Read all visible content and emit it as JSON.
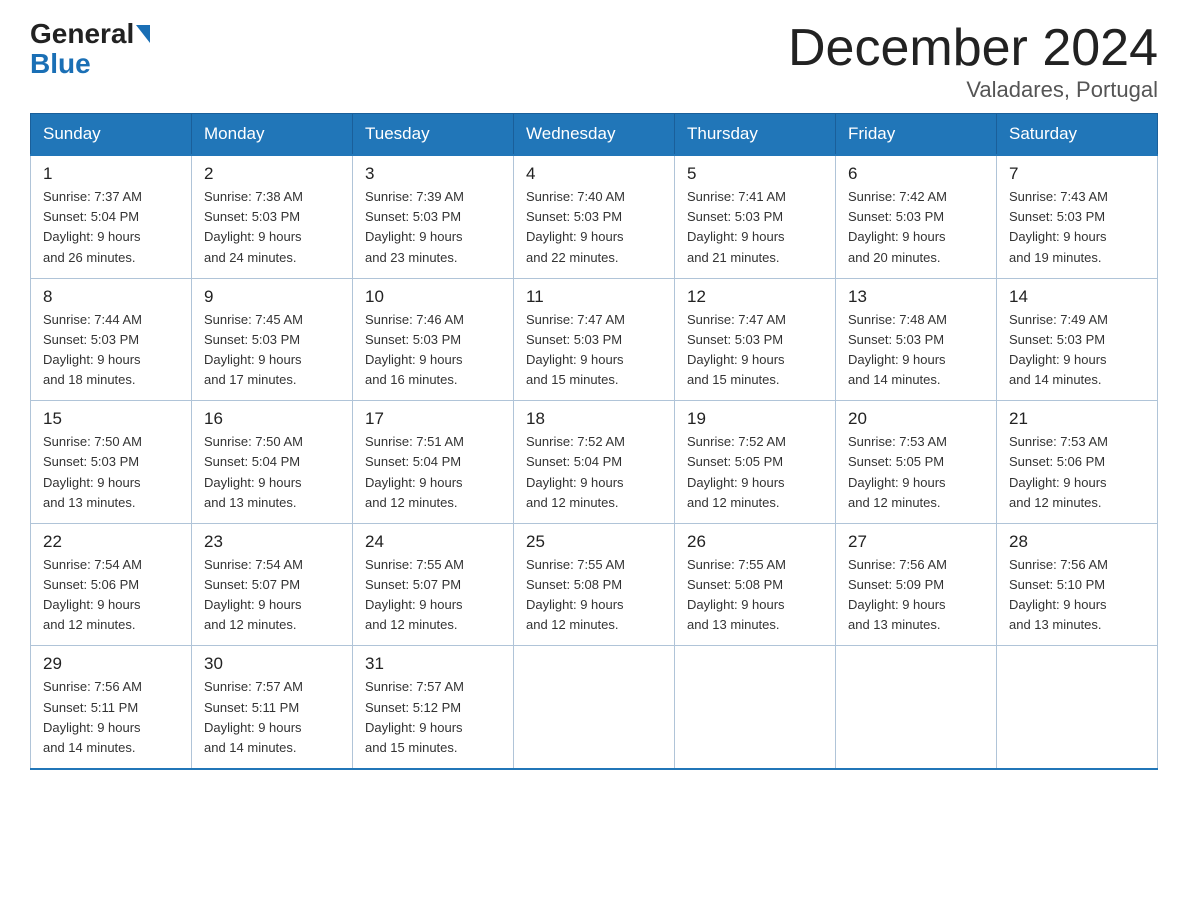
{
  "logo": {
    "general": "General",
    "blue": "Blue"
  },
  "header": {
    "month": "December 2024",
    "location": "Valadares, Portugal"
  },
  "days_of_week": [
    "Sunday",
    "Monday",
    "Tuesday",
    "Wednesday",
    "Thursday",
    "Friday",
    "Saturday"
  ],
  "weeks": [
    [
      {
        "day": "1",
        "sunrise": "7:37 AM",
        "sunset": "5:04 PM",
        "daylight": "9 hours and 26 minutes."
      },
      {
        "day": "2",
        "sunrise": "7:38 AM",
        "sunset": "5:03 PM",
        "daylight": "9 hours and 24 minutes."
      },
      {
        "day": "3",
        "sunrise": "7:39 AM",
        "sunset": "5:03 PM",
        "daylight": "9 hours and 23 minutes."
      },
      {
        "day": "4",
        "sunrise": "7:40 AM",
        "sunset": "5:03 PM",
        "daylight": "9 hours and 22 minutes."
      },
      {
        "day": "5",
        "sunrise": "7:41 AM",
        "sunset": "5:03 PM",
        "daylight": "9 hours and 21 minutes."
      },
      {
        "day": "6",
        "sunrise": "7:42 AM",
        "sunset": "5:03 PM",
        "daylight": "9 hours and 20 minutes."
      },
      {
        "day": "7",
        "sunrise": "7:43 AM",
        "sunset": "5:03 PM",
        "daylight": "9 hours and 19 minutes."
      }
    ],
    [
      {
        "day": "8",
        "sunrise": "7:44 AM",
        "sunset": "5:03 PM",
        "daylight": "9 hours and 18 minutes."
      },
      {
        "day": "9",
        "sunrise": "7:45 AM",
        "sunset": "5:03 PM",
        "daylight": "9 hours and 17 minutes."
      },
      {
        "day": "10",
        "sunrise": "7:46 AM",
        "sunset": "5:03 PM",
        "daylight": "9 hours and 16 minutes."
      },
      {
        "day": "11",
        "sunrise": "7:47 AM",
        "sunset": "5:03 PM",
        "daylight": "9 hours and 15 minutes."
      },
      {
        "day": "12",
        "sunrise": "7:47 AM",
        "sunset": "5:03 PM",
        "daylight": "9 hours and 15 minutes."
      },
      {
        "day": "13",
        "sunrise": "7:48 AM",
        "sunset": "5:03 PM",
        "daylight": "9 hours and 14 minutes."
      },
      {
        "day": "14",
        "sunrise": "7:49 AM",
        "sunset": "5:03 PM",
        "daylight": "9 hours and 14 minutes."
      }
    ],
    [
      {
        "day": "15",
        "sunrise": "7:50 AM",
        "sunset": "5:03 PM",
        "daylight": "9 hours and 13 minutes."
      },
      {
        "day": "16",
        "sunrise": "7:50 AM",
        "sunset": "5:04 PM",
        "daylight": "9 hours and 13 minutes."
      },
      {
        "day": "17",
        "sunrise": "7:51 AM",
        "sunset": "5:04 PM",
        "daylight": "9 hours and 12 minutes."
      },
      {
        "day": "18",
        "sunrise": "7:52 AM",
        "sunset": "5:04 PM",
        "daylight": "9 hours and 12 minutes."
      },
      {
        "day": "19",
        "sunrise": "7:52 AM",
        "sunset": "5:05 PM",
        "daylight": "9 hours and 12 minutes."
      },
      {
        "day": "20",
        "sunrise": "7:53 AM",
        "sunset": "5:05 PM",
        "daylight": "9 hours and 12 minutes."
      },
      {
        "day": "21",
        "sunrise": "7:53 AM",
        "sunset": "5:06 PM",
        "daylight": "9 hours and 12 minutes."
      }
    ],
    [
      {
        "day": "22",
        "sunrise": "7:54 AM",
        "sunset": "5:06 PM",
        "daylight": "9 hours and 12 minutes."
      },
      {
        "day": "23",
        "sunrise": "7:54 AM",
        "sunset": "5:07 PM",
        "daylight": "9 hours and 12 minutes."
      },
      {
        "day": "24",
        "sunrise": "7:55 AM",
        "sunset": "5:07 PM",
        "daylight": "9 hours and 12 minutes."
      },
      {
        "day": "25",
        "sunrise": "7:55 AM",
        "sunset": "5:08 PM",
        "daylight": "9 hours and 12 minutes."
      },
      {
        "day": "26",
        "sunrise": "7:55 AM",
        "sunset": "5:08 PM",
        "daylight": "9 hours and 13 minutes."
      },
      {
        "day": "27",
        "sunrise": "7:56 AM",
        "sunset": "5:09 PM",
        "daylight": "9 hours and 13 minutes."
      },
      {
        "day": "28",
        "sunrise": "7:56 AM",
        "sunset": "5:10 PM",
        "daylight": "9 hours and 13 minutes."
      }
    ],
    [
      {
        "day": "29",
        "sunrise": "7:56 AM",
        "sunset": "5:11 PM",
        "daylight": "9 hours and 14 minutes."
      },
      {
        "day": "30",
        "sunrise": "7:57 AM",
        "sunset": "5:11 PM",
        "daylight": "9 hours and 14 minutes."
      },
      {
        "day": "31",
        "sunrise": "7:57 AM",
        "sunset": "5:12 PM",
        "daylight": "9 hours and 15 minutes."
      },
      null,
      null,
      null,
      null
    ]
  ],
  "labels": {
    "sunrise": "Sunrise:",
    "sunset": "Sunset:",
    "daylight": "Daylight:"
  }
}
